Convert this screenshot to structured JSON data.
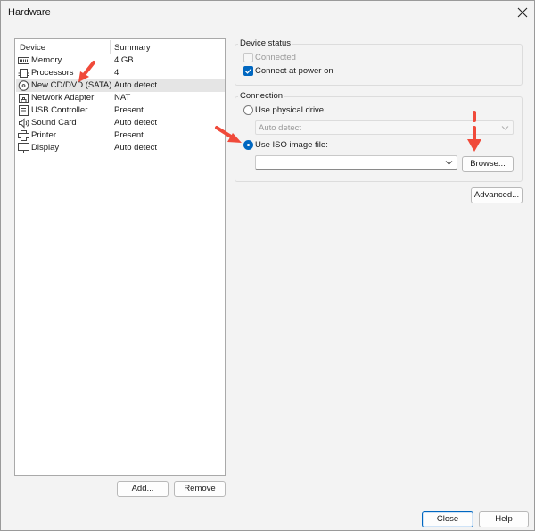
{
  "window": {
    "title": "Hardware"
  },
  "device_list": {
    "col_device": "Device",
    "col_summary": "Summary",
    "rows": [
      {
        "icon": "memory-icon",
        "name": "Memory",
        "summary": "4 GB",
        "selected": false
      },
      {
        "icon": "processor-icon",
        "name": "Processors",
        "summary": "4",
        "selected": false
      },
      {
        "icon": "cd-dvd-icon",
        "name": "New CD/DVD (SATA)",
        "summary": "Auto detect",
        "selected": true
      },
      {
        "icon": "network-adapter-icon",
        "name": "Network Adapter",
        "summary": "NAT",
        "selected": false
      },
      {
        "icon": "usb-icon",
        "name": "USB Controller",
        "summary": "Present",
        "selected": false
      },
      {
        "icon": "sound-card-icon",
        "name": "Sound Card",
        "summary": "Auto detect",
        "selected": false
      },
      {
        "icon": "printer-icon",
        "name": "Printer",
        "summary": "Present",
        "selected": false
      },
      {
        "icon": "display-icon",
        "name": "Display",
        "summary": "Auto detect",
        "selected": false
      }
    ],
    "add_label": "Add...",
    "remove_label": "Remove"
  },
  "device_status": {
    "group_label": "Device status",
    "connected_label": "Connected",
    "connected_checked": false,
    "connect_power_label": "Connect at power on",
    "connect_power_checked": true
  },
  "connection": {
    "group_label": "Connection",
    "physical_label": "Use physical drive:",
    "physical_selected": false,
    "physical_value": "Auto detect",
    "iso_label": "Use ISO image file:",
    "iso_selected": true,
    "iso_value": "",
    "browse_label": "Browse..."
  },
  "advanced_label": "Advanced...",
  "footer": {
    "close_label": "Close",
    "help_label": "Help"
  },
  "colors": {
    "accent": "#0067c0",
    "annotation_arrow": "#f04a3a"
  }
}
